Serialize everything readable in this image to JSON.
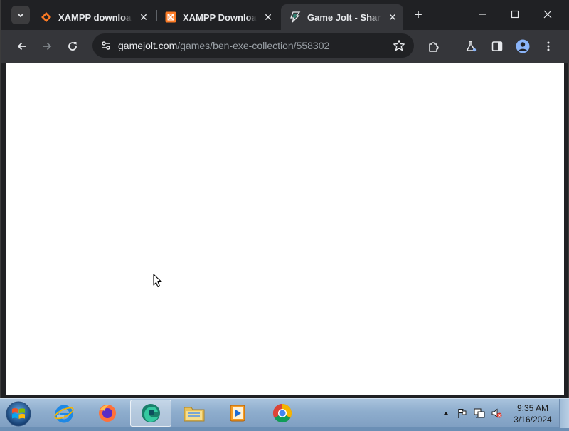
{
  "browser": {
    "tabs": [
      {
        "title": "XAMPP download |",
        "favicon": "xampp-orange-diamond-icon",
        "active": false
      },
      {
        "title": "XAMPP Download",
        "favicon": "xampp-square-icon",
        "active": false
      },
      {
        "title": "Game Jolt - Share y",
        "favicon": "gamejolt-bolt-icon",
        "active": true
      }
    ],
    "new_tab_label": "+",
    "close_glyph": "✕",
    "url_host": "gamejolt.com",
    "url_path": "/games/ben-exe-collection/558302"
  },
  "taskbar": {
    "apps": [
      {
        "name": "internet-explorer-icon"
      },
      {
        "name": "firefox-icon"
      },
      {
        "name": "edge-icon",
        "active": true
      },
      {
        "name": "file-explorer-icon"
      },
      {
        "name": "media-player-icon"
      },
      {
        "name": "chrome-icon"
      }
    ],
    "clock": {
      "time": "9:35 AM",
      "date": "3/16/2024"
    }
  },
  "colors": {
    "tabstrip_bg": "#202124",
    "toolbar_bg": "#35363a",
    "omnibox_bg": "#202124",
    "page_bg": "#ffffff",
    "taskbar_bg": "#8eadcd"
  }
}
